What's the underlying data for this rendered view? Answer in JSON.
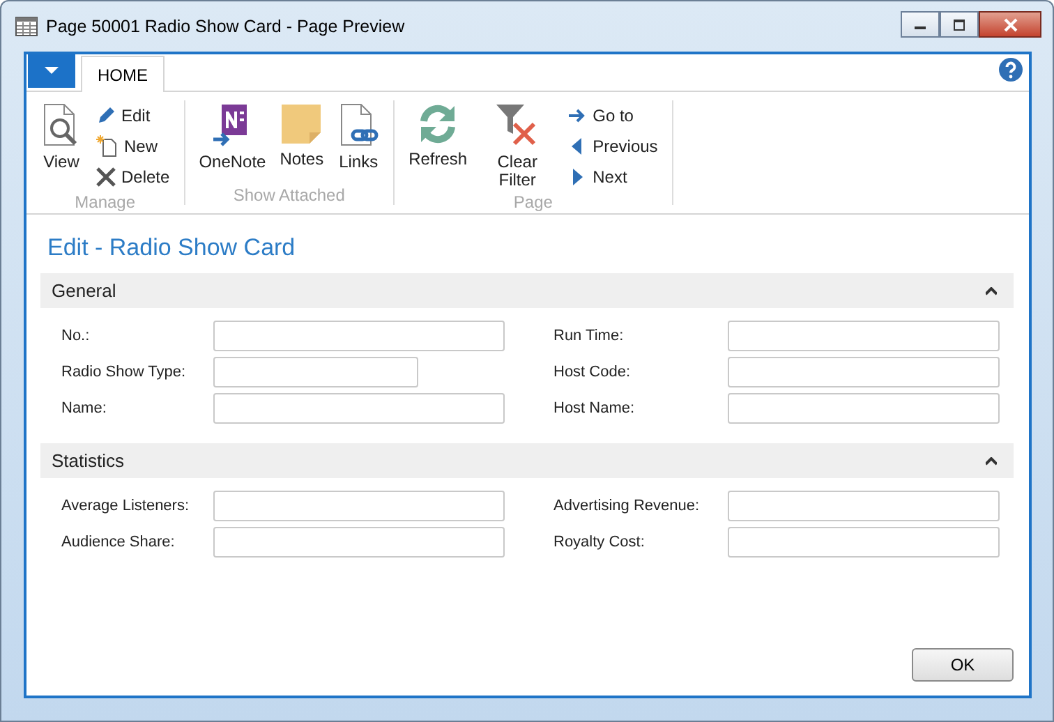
{
  "window": {
    "title": "Page 50001 Radio Show Card - Page Preview"
  },
  "tabs": [
    {
      "label": "HOME",
      "selected": true
    }
  ],
  "ribbon_groups": [
    {
      "label": "Manage",
      "items": [
        {
          "kind": "large",
          "label": "View"
        },
        {
          "kind": "small",
          "label": "Edit"
        },
        {
          "kind": "small",
          "label": "New"
        },
        {
          "kind": "small",
          "label": "Delete"
        }
      ]
    },
    {
      "label": "Show Attached",
      "items": [
        {
          "kind": "large",
          "label": "OneNote"
        },
        {
          "kind": "large",
          "label": "Notes"
        },
        {
          "kind": "large",
          "label": "Links"
        }
      ]
    },
    {
      "label": "Page",
      "items": [
        {
          "kind": "large",
          "label": "Refresh"
        },
        {
          "kind": "large",
          "label": "Clear Filter"
        },
        {
          "kind": "small",
          "label": "Go to"
        },
        {
          "kind": "small",
          "label": "Previous"
        },
        {
          "kind": "small",
          "label": "Next"
        }
      ]
    }
  ],
  "page_title": "Edit - Radio Show Card",
  "sections": [
    {
      "title": "General",
      "expanded": true,
      "left": [
        {
          "label": "No.:",
          "kind": "wide"
        },
        {
          "label": "Radio Show Type:",
          "kind": "short"
        },
        {
          "label": "Name:",
          "kind": "wide"
        }
      ],
      "right": [
        {
          "label": "Run Time:",
          "kind": "wide"
        },
        {
          "label": "Host Code:",
          "kind": "wide"
        },
        {
          "label": "Host Name:",
          "kind": "wide"
        }
      ]
    },
    {
      "title": "Statistics",
      "expanded": true,
      "left": [
        {
          "label": "Average Listeners:",
          "kind": "wide"
        },
        {
          "label": "Audience Share:",
          "kind": "wide"
        }
      ],
      "right": [
        {
          "label": "Advertising Revenue:",
          "kind": "wide"
        },
        {
          "label": "Royalty Cost:",
          "kind": "wide"
        }
      ]
    }
  ],
  "buttons": [
    "OK"
  ]
}
